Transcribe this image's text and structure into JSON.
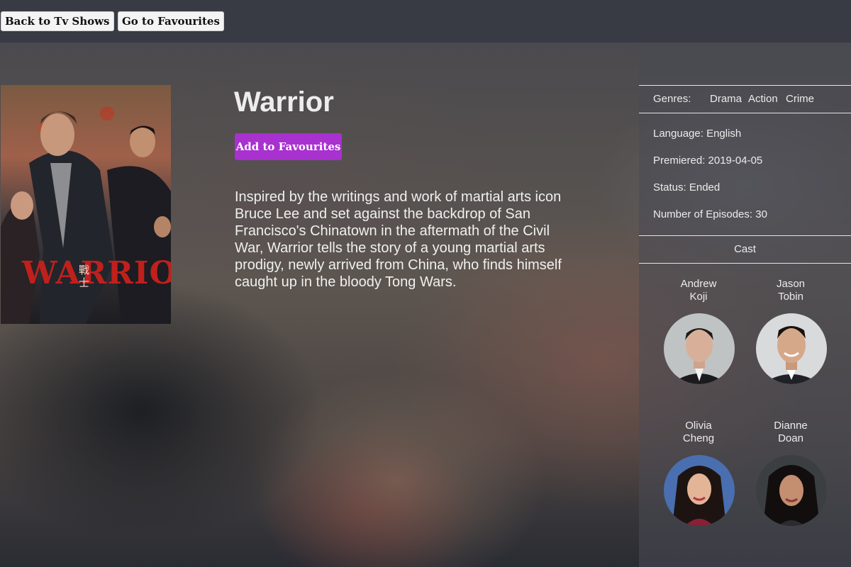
{
  "nav": {
    "back_label": "Back to Tv Shows",
    "favourites_label": "Go to Favourites"
  },
  "show": {
    "title": "Warrior",
    "add_favourite_label": "Add to Favourites",
    "summary": "Inspired by the writings and work of martial arts icon Bruce Lee and set against the backdrop of San Francisco's Chinatown in the aftermath of the Civil War, Warrior tells the story of a young martial arts prodigy, newly arrived from China, who finds himself caught up in the bloody Tong Wars.",
    "poster_text": "WARRIOR",
    "poster_glyphs": "戰士"
  },
  "details": {
    "genres_label": "Genres:",
    "genres": [
      "Drama",
      "Action",
      "Crime"
    ],
    "language": "Language: English",
    "premiered": "Premiered: 2019-04-05",
    "status": "Status: Ended",
    "episodes": "Number of Episodes: 30"
  },
  "cast": {
    "title": "Cast",
    "members": [
      {
        "first": "Andrew",
        "last": "Koji"
      },
      {
        "first": "Jason",
        "last": "Tobin"
      },
      {
        "first": "Olivia",
        "last": "Cheng"
      },
      {
        "first": "Dianne",
        "last": "Doan"
      }
    ]
  },
  "colors": {
    "accent": "#a831cf",
    "topbar": "#383b44",
    "poster_title_red": "#c0201c"
  }
}
